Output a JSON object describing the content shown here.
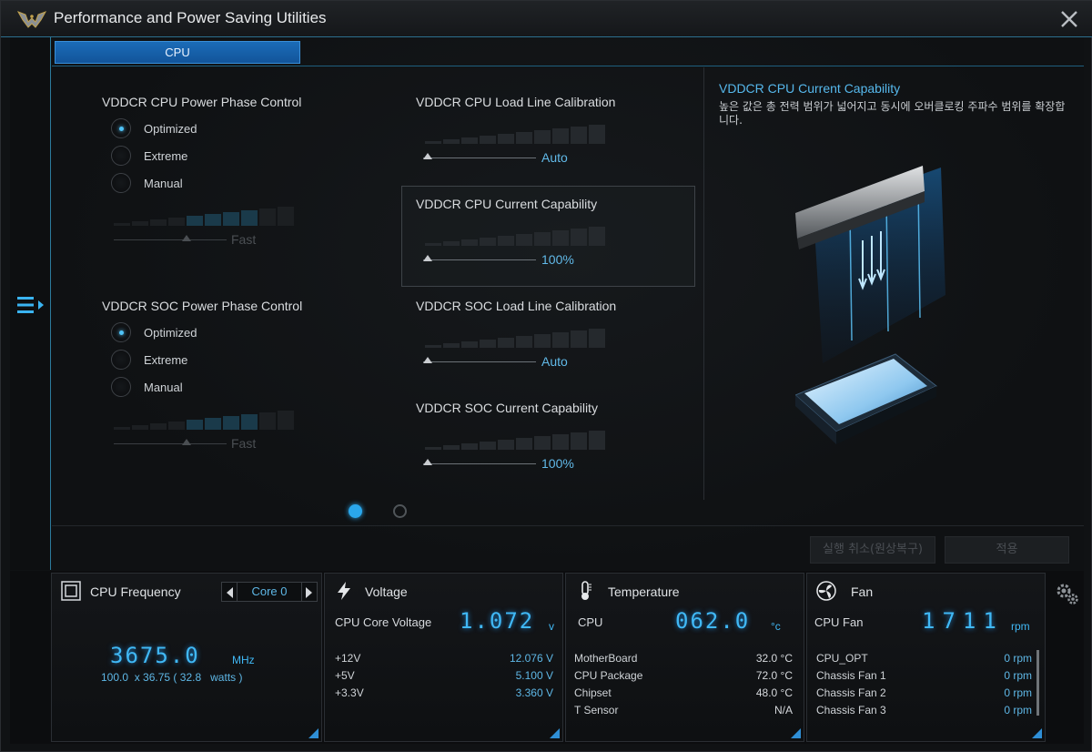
{
  "window": {
    "title": "Performance and Power Saving Utilities"
  },
  "tabs": [
    {
      "label": "CPU",
      "active": true
    }
  ],
  "cpu_phase": {
    "title": "VDDCR CPU Power Phase Control",
    "options": [
      "Optimized",
      "Extreme",
      "Manual"
    ],
    "selected": "Optimized",
    "slider_value": "Fast"
  },
  "soc_phase": {
    "title": "VDDCR SOC Power Phase Control",
    "options": [
      "Optimized",
      "Extreme",
      "Manual"
    ],
    "selected": "Optimized",
    "slider_value": "Fast"
  },
  "cpu_llc": {
    "title": "VDDCR CPU Load Line Calibration",
    "value": "Auto"
  },
  "cpu_current": {
    "title": "VDDCR CPU Current Capability",
    "value": "100%"
  },
  "soc_llc": {
    "title": "VDDCR SOC Load Line Calibration",
    "value": "Auto"
  },
  "soc_current": {
    "title": "VDDCR SOC Current Capability",
    "value": "100%"
  },
  "info": {
    "title": "VDDCR CPU Current Capability",
    "description": "높은 값은 총 전력 범위가 넓어지고 동시에 오버클로킹 주파수 범위를 확장합니다."
  },
  "pagination": {
    "pages": 2,
    "current": 1
  },
  "buttons": {
    "undo": "실행 취소(원상복구)",
    "apply": "적용"
  },
  "monitor": {
    "frequency": {
      "title": "CPU Frequency",
      "core": "Core 0",
      "value": "3675.0",
      "unit": "MHz",
      "multiplier": "100.0",
      "x": "x",
      "ratio": "36.75",
      "watts_prefix": "(",
      "watts": "32.8",
      "watts_suffix": "watts )"
    },
    "voltage": {
      "title": "Voltage",
      "primary_label": "CPU Core Voltage",
      "primary_value": "1.072",
      "primary_unit": "v",
      "rows": [
        {
          "label": "+12V",
          "value": "12.076  V"
        },
        {
          "label": "+5V",
          "value": "5.100  V"
        },
        {
          "label": "+3.3V",
          "value": "3.360  V"
        }
      ]
    },
    "temperature": {
      "title": "Temperature",
      "primary_label": "CPU",
      "primary_value": "062.0",
      "primary_unit": "°c",
      "rows": [
        {
          "label": "MotherBoard",
          "value": "32.0 °C"
        },
        {
          "label": "CPU Package",
          "value": "72.0 °C"
        },
        {
          "label": "Chipset",
          "value": "48.0 °C"
        },
        {
          "label": "T Sensor",
          "value": "N/A"
        }
      ]
    },
    "fan": {
      "title": "Fan",
      "primary_label": "CPU Fan",
      "primary_value": "1711",
      "primary_unit": "rpm",
      "rows": [
        {
          "label": "CPU_OPT",
          "value": "0  rpm"
        },
        {
          "label": "Chassis Fan 1",
          "value": "0  rpm"
        },
        {
          "label": "Chassis Fan 2",
          "value": "0  rpm"
        },
        {
          "label": "Chassis Fan 3",
          "value": "0  rpm"
        }
      ]
    }
  },
  "colors": {
    "accent": "#2aa7ec",
    "value_text": "#5eb7e6",
    "tab_active": "#1b6cb8"
  },
  "icons": [
    "tuf-logo-icon",
    "close-icon",
    "menu-expand-icon",
    "cpu-chip-icon",
    "lightning-icon",
    "thermometer-icon",
    "fan-icon",
    "gear-icon"
  ]
}
